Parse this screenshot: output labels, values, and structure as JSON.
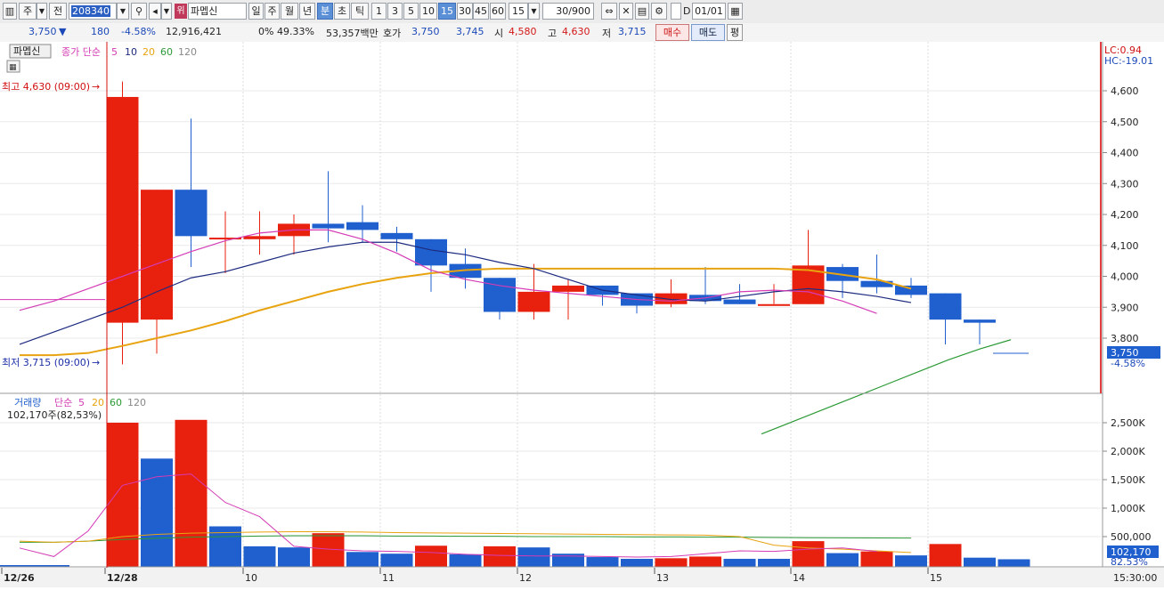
{
  "toolbar": {
    "market": "주",
    "prev": "전",
    "code": "208340",
    "badge": "위",
    "stock_name": "파멥신",
    "periods": [
      "일",
      "주",
      "월",
      "년",
      "분",
      "초",
      "틱"
    ],
    "selected_period": "분",
    "intervals": [
      "1",
      "3",
      "5",
      "10",
      "15",
      "30",
      "45",
      "60"
    ],
    "selected_interval": "15",
    "interval_value": "15",
    "count": "30/900",
    "checkbox_label": "D",
    "date": "01/01"
  },
  "quote": {
    "price": "3,750",
    "arrow": "▼",
    "change": "180",
    "rate": "-4.58%",
    "volume": "12,916,421",
    "ratio": "0% 49.33%",
    "amount": "53,357백만",
    "ask_label": "호가",
    "ask1": "3,750",
    "ask2": "3,745",
    "open_label": "시",
    "open": "4,580",
    "high_label": "고",
    "high": "4,630",
    "low_label": "저",
    "low": "3,715",
    "buy": "매수",
    "sell": "매도",
    "avg": "평"
  },
  "price_panel": {
    "tag": "파멥신",
    "ma_prefix": "종가 단순",
    "ma_periods": [
      "5",
      "10",
      "20",
      "60",
      "120"
    ],
    "lc": "LC:0.94",
    "hc": "HC:-19.01",
    "high_marker": "최고 4,630 (09:00)",
    "low_marker": "최저 3,715 (09:00)",
    "y_ticks": [
      "4,600",
      "4,500",
      "4,400",
      "4,300",
      "4,200",
      "4,100",
      "4,000",
      "3,900",
      "3,800"
    ],
    "cur_price": "3,750",
    "cur_rate": "-4.58%"
  },
  "volume_panel": {
    "label": "거래량",
    "ma_prefix": "단순",
    "ma_periods": [
      "5",
      "20",
      "60",
      "120"
    ],
    "info": "102,170주(82,53%)",
    "y_ticks": [
      "2,500K",
      "2,000K",
      "1,500K",
      "1,000K",
      "500,000"
    ],
    "cur_volume": "102,170",
    "cur_ratio": "82.53%"
  },
  "x_axis": {
    "labels": [
      "12/26",
      "12/28",
      "10",
      "11",
      "12",
      "13",
      "14",
      "15"
    ],
    "time": "15:30:00"
  },
  "colors": {
    "up": "#e8210e",
    "down": "#1f5fce",
    "ma5": "#d43cb6",
    "ma10": "#1d2b80",
    "ma20": "#e8a310",
    "ma60": "#2c9a36",
    "ma120": "#888888"
  },
  "chart_data": {
    "type": "candlestick",
    "candles": [
      {
        "o": 3850,
        "h": 4630,
        "l": 3715,
        "c": 4580
      },
      {
        "o": 3860,
        "h": 4280,
        "l": 3750,
        "c": 4280
      },
      {
        "o": 4280,
        "h": 4510,
        "l": 4030,
        "c": 4130
      },
      {
        "o": 4125,
        "h": 4210,
        "l": 4010,
        "c": 4125
      },
      {
        "o": 4120,
        "h": 4210,
        "l": 4070,
        "c": 4130
      },
      {
        "o": 4130,
        "h": 4200,
        "l": 4070,
        "c": 4170
      },
      {
        "o": 4170,
        "h": 4340,
        "l": 4110,
        "c": 4155
      },
      {
        "o": 4175,
        "h": 4230,
        "l": 4110,
        "c": 4150
      },
      {
        "o": 4140,
        "h": 4160,
        "l": 4080,
        "c": 4120
      },
      {
        "o": 4120,
        "h": 4120,
        "l": 3950,
        "c": 4035
      },
      {
        "o": 4040,
        "h": 4090,
        "l": 3960,
        "c": 3995
      },
      {
        "o": 3995,
        "h": 3995,
        "l": 3860,
        "c": 3885
      },
      {
        "o": 3885,
        "h": 4040,
        "l": 3860,
        "c": 3950
      },
      {
        "o": 3950,
        "h": 3990,
        "l": 3860,
        "c": 3970
      },
      {
        "o": 3970,
        "h": 3970,
        "l": 3905,
        "c": 3940
      },
      {
        "o": 3945,
        "h": 3945,
        "l": 3880,
        "c": 3905
      },
      {
        "o": 3910,
        "h": 3990,
        "l": 3900,
        "c": 3945
      },
      {
        "o": 3940,
        "h": 4030,
        "l": 3910,
        "c": 3920
      },
      {
        "o": 3925,
        "h": 3975,
        "l": 3910,
        "c": 3910
      },
      {
        "o": 3910,
        "h": 3975,
        "l": 3910,
        "c": 3910
      },
      {
        "o": 3910,
        "h": 4150,
        "l": 3910,
        "c": 4035
      },
      {
        "o": 4030,
        "h": 4040,
        "l": 3930,
        "c": 3985
      },
      {
        "o": 3985,
        "h": 4070,
        "l": 3945,
        "c": 3965
      },
      {
        "o": 3970,
        "h": 3995,
        "l": 3930,
        "c": 3940
      },
      {
        "o": 3945,
        "h": 3945,
        "l": 3780,
        "c": 3860
      },
      {
        "o": 3860,
        "h": 3860,
        "l": 3780,
        "c": 3850
      }
    ],
    "volumes": [
      {
        "v": 2500000,
        "up": true
      },
      {
        "v": 1870000,
        "up": false
      },
      {
        "v": 2550000,
        "up": true
      },
      {
        "v": 680000,
        "up": false
      },
      {
        "v": 330000,
        "up": false
      },
      {
        "v": 310000,
        "up": false
      },
      {
        "v": 560000,
        "up": true
      },
      {
        "v": 230000,
        "up": false
      },
      {
        "v": 200000,
        "up": false
      },
      {
        "v": 340000,
        "up": true
      },
      {
        "v": 190000,
        "up": false
      },
      {
        "v": 330000,
        "up": true
      },
      {
        "v": 310000,
        "up": false
      },
      {
        "v": 200000,
        "up": false
      },
      {
        "v": 140000,
        "up": false
      },
      {
        "v": 110000,
        "up": false
      },
      {
        "v": 120000,
        "up": true
      },
      {
        "v": 150000,
        "up": true
      },
      {
        "v": 110000,
        "up": false
      },
      {
        "v": 110000,
        "up": false
      },
      {
        "v": 420000,
        "up": true
      },
      {
        "v": 210000,
        "up": false
      },
      {
        "v": 240000,
        "up": true
      },
      {
        "v": 170000,
        "up": false
      },
      {
        "v": 370000,
        "up": true
      },
      {
        "v": 130000,
        "up": false
      },
      {
        "v": 102170,
        "up": false
      }
    ],
    "ma5_price": [
      3890,
      3920,
      3960,
      4000,
      4040,
      4080,
      4115,
      4140,
      4150,
      4150,
      4120,
      4075,
      4020,
      3990,
      3970,
      3955,
      3945,
      3935,
      3925,
      3920,
      3930,
      3950,
      3955,
      3950,
      3920,
      3880
    ],
    "ma10_price": [
      3780,
      3820,
      3860,
      3900,
      3950,
      3995,
      4015,
      4045,
      4075,
      4095,
      4110,
      4110,
      4085,
      4070,
      4045,
      4025,
      3990,
      3955,
      3940,
      3925,
      3920,
      3935,
      3950,
      3960,
      3950,
      3935,
      3915
    ],
    "ma20_price": [
      3745,
      3745,
      3752,
      3775,
      3800,
      3825,
      3855,
      3890,
      3920,
      3950,
      3975,
      3995,
      4010,
      4020,
      4025,
      4025,
      4025,
      4025,
      4025,
      4025,
      4025,
      4025,
      4025,
      4020,
      4005,
      3990,
      3960
    ],
    "ma60_price": [
      3490,
      3530,
      3570,
      3610,
      3650,
      3690,
      3730,
      3765,
      3795
    ],
    "ma5_volume": [
      300000,
      150000,
      600000,
      1400000,
      1550000,
      1600000,
      1100000,
      850000,
      330000,
      280000,
      250000,
      240000,
      220000,
      190000,
      170000,
      160000,
      160000,
      150000,
      140000,
      150000,
      200000,
      250000,
      240000,
      280000,
      300000,
      240000
    ],
    "ma20_volume": [
      420000,
      400000,
      420000,
      500000,
      540000,
      560000,
      570000,
      580000,
      585000,
      585000,
      580000,
      570000,
      565000,
      560000,
      555000,
      550000,
      545000,
      540000,
      535000,
      530000,
      525000,
      500000,
      350000,
      300000,
      280000,
      250000,
      220000
    ],
    "ma60_volume": [
      400000,
      400000,
      420000,
      450000,
      470000,
      490000,
      500000,
      510000,
      515000,
      515000,
      515000,
      510000,
      510000,
      505000,
      505000,
      500000,
      500000,
      500000,
      495000,
      495000,
      490000,
      490000,
      485000,
      480000,
      478000,
      476000,
      475000
    ]
  }
}
